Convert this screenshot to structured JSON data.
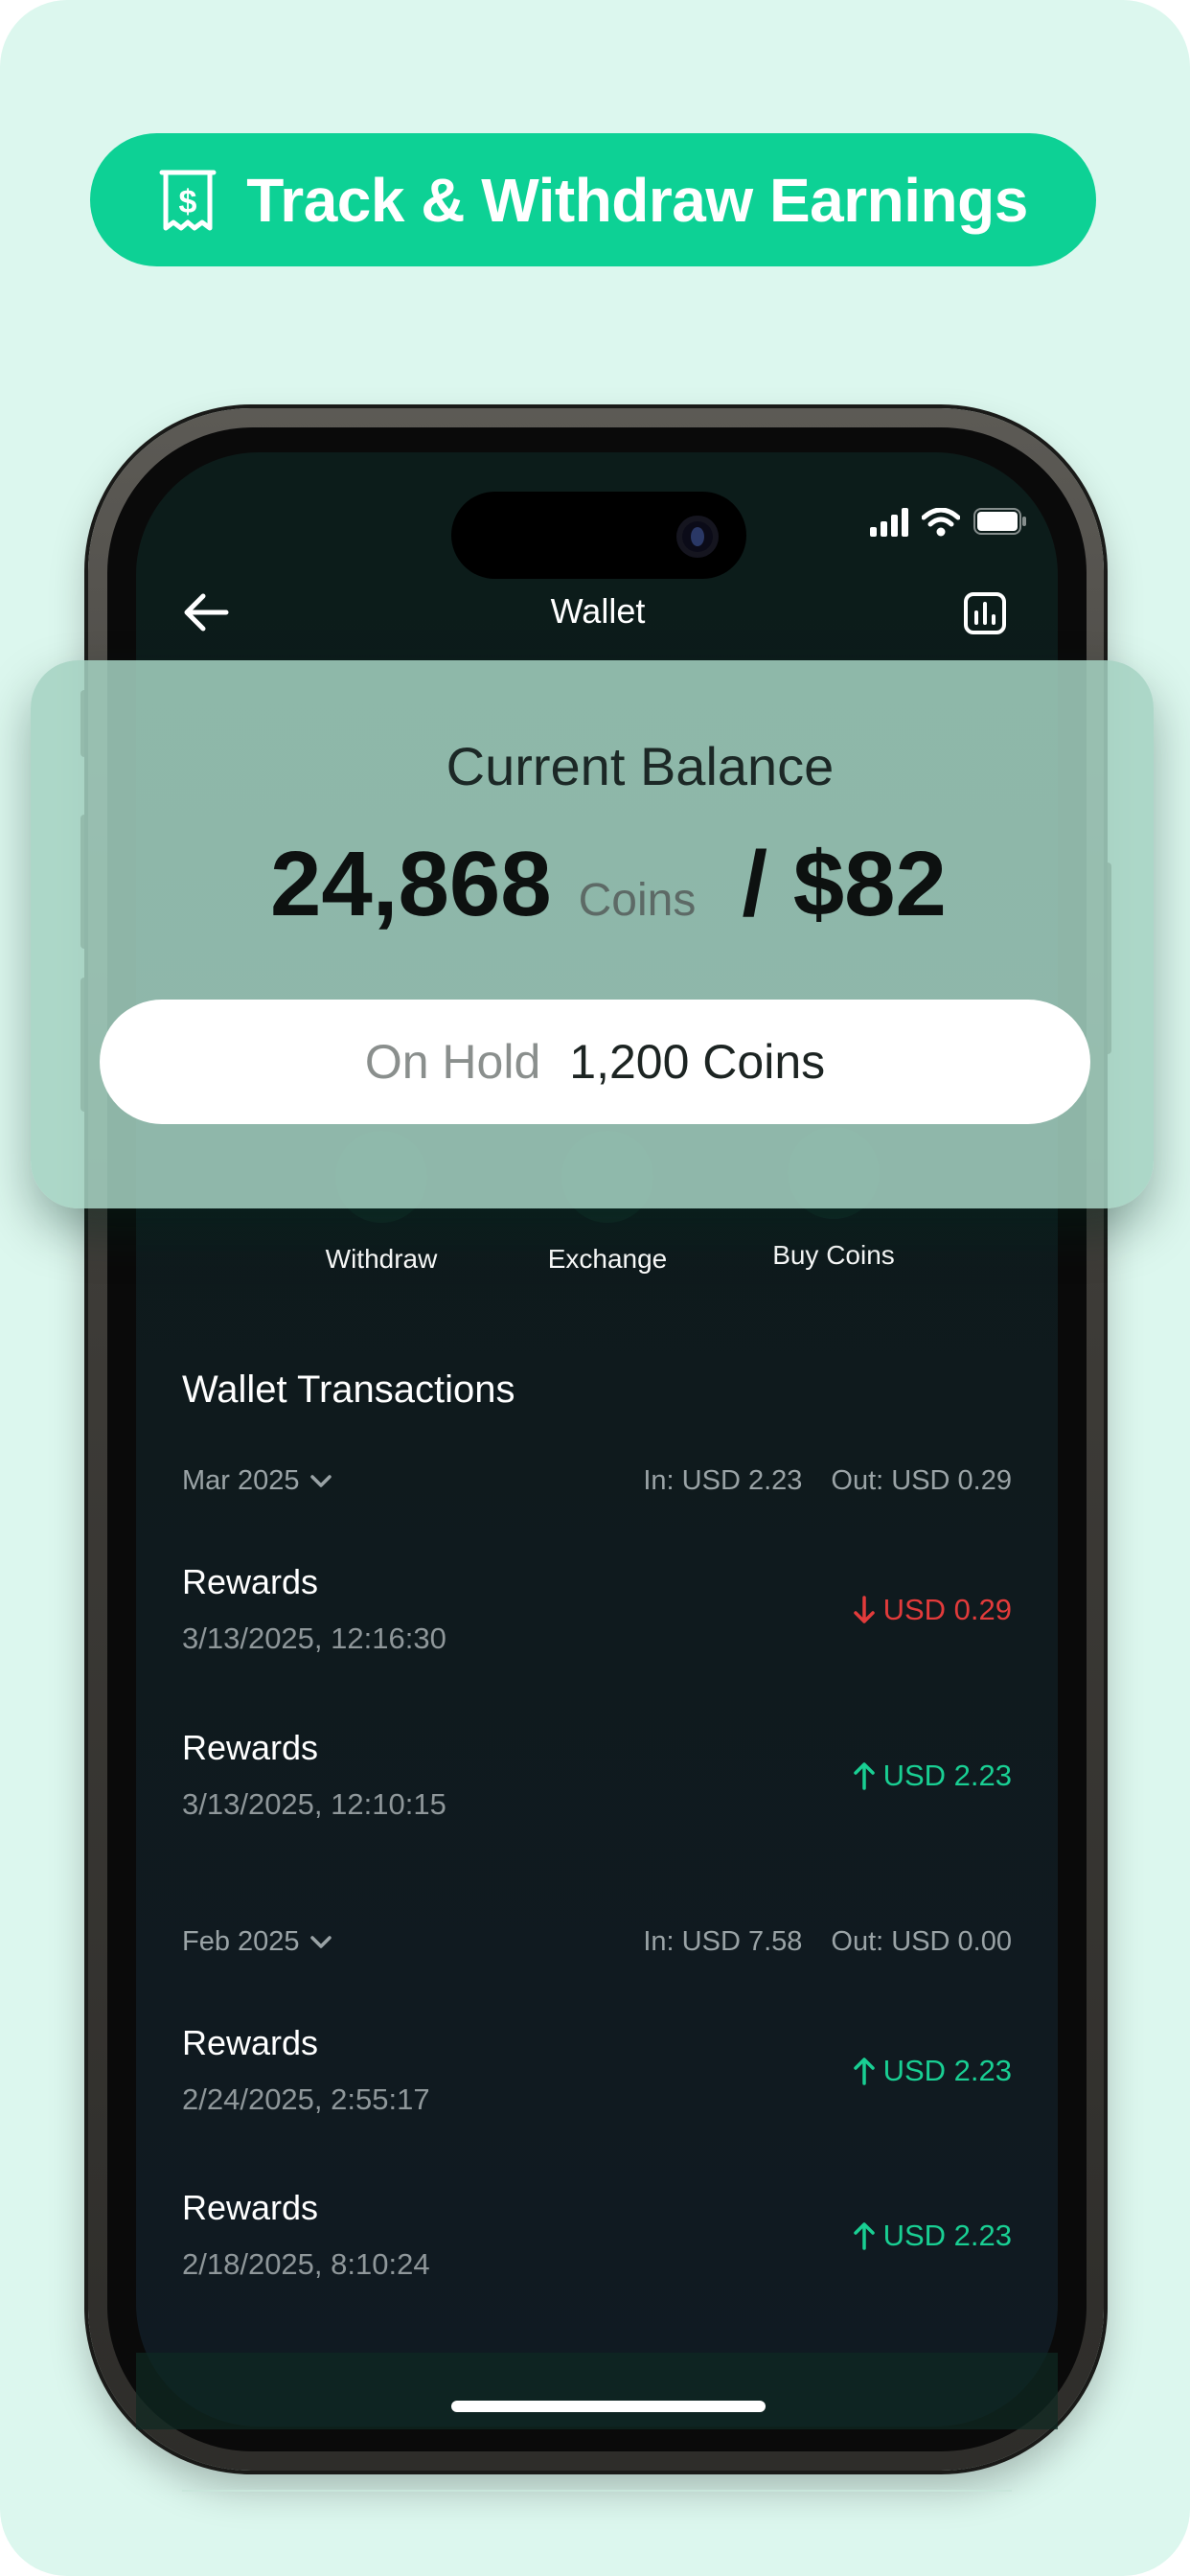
{
  "header": {
    "title": "Track & Withdraw Earnings",
    "icon": "receipt-dollar-icon",
    "background_color": "#0dd195"
  },
  "nav": {
    "title": "Wallet",
    "back_icon": "arrow-left-icon",
    "stats_icon": "bar-chart-icon"
  },
  "balance": {
    "label": "Current Balance",
    "coins": "24,868",
    "coins_unit": "Coins",
    "usd": "/ $82",
    "hold_label": "On Hold",
    "hold_value": "1,200 Coins"
  },
  "actions": [
    {
      "label": "Withdraw",
      "icon": "withdraw-icon"
    },
    {
      "label": "Exchange",
      "icon": "exchange-icon"
    },
    {
      "label": "Buy Coins",
      "icon": "buy-coins-icon"
    }
  ],
  "transactions": {
    "title": "Wallet Transactions",
    "groups": [
      {
        "month": "Mar 2025",
        "in": "In: USD 2.23",
        "out": "Out: USD 0.29",
        "items": [
          {
            "name": "Rewards",
            "date": "3/13/2025, 12:16:30",
            "amount": "USD 0.29",
            "direction": "out"
          },
          {
            "name": "Rewards",
            "date": "3/13/2025, 12:10:15",
            "amount": "USD 2.23",
            "direction": "in"
          }
        ]
      },
      {
        "month": "Feb 2025",
        "in": "In: USD 7.58",
        "out": "Out: USD 0.00",
        "items": [
          {
            "name": "Rewards",
            "date": "2/24/2025, 2:55:17",
            "amount": "USD 2.23",
            "direction": "in"
          },
          {
            "name": "Rewards",
            "date": "2/18/2025, 8:10:24",
            "amount": "USD 2.23",
            "direction": "in"
          }
        ]
      }
    ]
  },
  "colors": {
    "accent": "#0dd195",
    "incoming": "#19cf93",
    "outgoing": "#e23b3b",
    "page_background": "#dcf7ee"
  }
}
